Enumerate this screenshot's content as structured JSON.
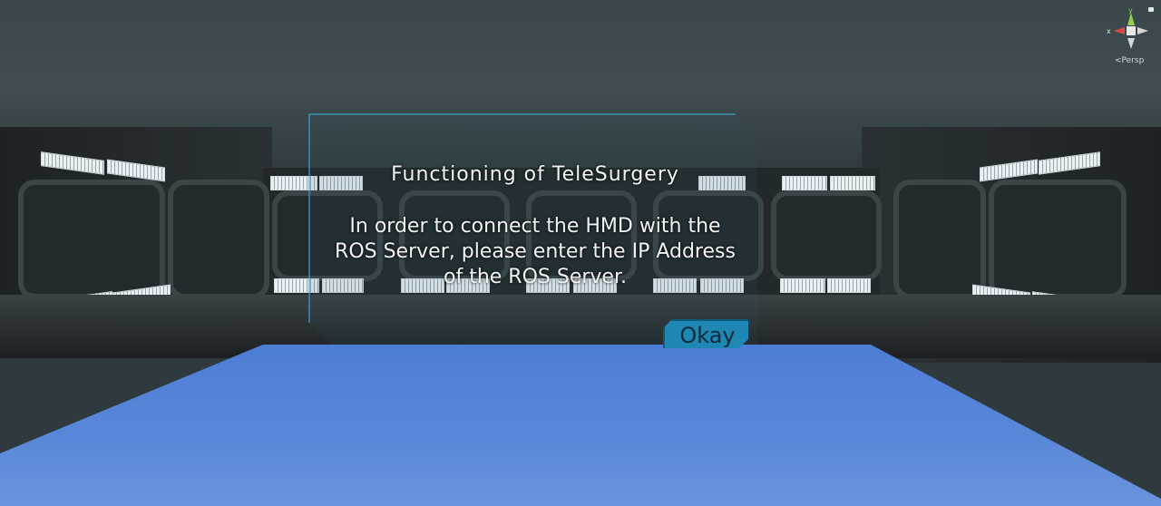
{
  "dialog": {
    "title": "Functioning of TeleSurgery",
    "body": "In order to connect the HMD with the ROS Server, please enter the IP Address of the ROS Server.",
    "button_label": "Okay"
  },
  "scene_gizmo": {
    "view_label": "<Persp",
    "axis_y": "y",
    "axis_x": "x"
  },
  "colors": {
    "floor": "#5a88d8",
    "button": "#1f87b3",
    "dialog_border": "#46aad2"
  }
}
